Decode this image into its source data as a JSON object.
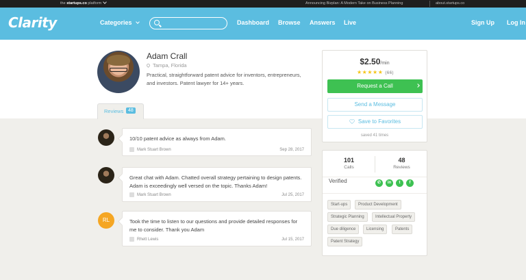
{
  "topbar": {
    "platform_prefix": "the ",
    "platform_brand": "startups.co",
    "platform_suffix": " platform",
    "announcement": "Announcing Bizplan: A Modern Take on Business Planning",
    "about_link": "about.startups.co"
  },
  "header": {
    "logo": "Clarity",
    "categories": "Categories",
    "search_placeholder": "",
    "nav": [
      "Dashboard",
      "Browse",
      "Answers",
      "Live"
    ],
    "signup": "Sign Up",
    "login": "Log In"
  },
  "profile": {
    "name": "Adam Crall",
    "location": "Tampa, Florida",
    "bio": "Practical, straightforward patent advice for inventors, entrepreneurs, and investors. Patent lawyer for 14+ years."
  },
  "tabs": {
    "reviews_label": "Reviews",
    "reviews_count": "48"
  },
  "reviews": [
    {
      "text": "10/10 patent advice as always from Adam.",
      "author": "Mark Stuart Brown",
      "date": "Sep 28, 2017",
      "avatar": "photo"
    },
    {
      "text": "Great chat with Adam. Chatted overall strategy pertaining to design patents. Adam is exceedingly well versed on the topic. Thanks Adam!",
      "author": "Mark Stuart Brown",
      "date": "Jul 25, 2017",
      "avatar": "photo"
    },
    {
      "text": "Took the time to listen to our questions and provide detailed responses for me to consider. Thank you Adam",
      "author": "Rhett Lewis",
      "date": "Jul 15, 2017",
      "avatar": "RL"
    }
  ],
  "booking": {
    "price": "$2.50",
    "price_unit": "/min",
    "stars": "★★★★★",
    "rating": 5,
    "rating_count": "(66)",
    "request_call": "Request a Call",
    "send_message": "Send a Message",
    "save_favorites": "Save to Favorites",
    "saved_times": "saved 41 times"
  },
  "stats": {
    "calls_value": "101",
    "calls_label": "Calls",
    "reviews_value": "48",
    "reviews_label": "Reviews",
    "verified_label": "Verified",
    "verified_icons": [
      "phone-icon",
      "linkedin-icon",
      "twitter-icon",
      "facebook-icon"
    ]
  },
  "tags": [
    "Start-ups",
    "Product Development",
    "Strategic Planning",
    "Intellectual Property",
    "Due diligence",
    "Licensing",
    "Patents",
    "Patent Strategy"
  ],
  "colors": {
    "brand": "#5bbde0",
    "success": "#3ec152",
    "star": "#f5c518",
    "initials_avatar": "#f5a623"
  }
}
